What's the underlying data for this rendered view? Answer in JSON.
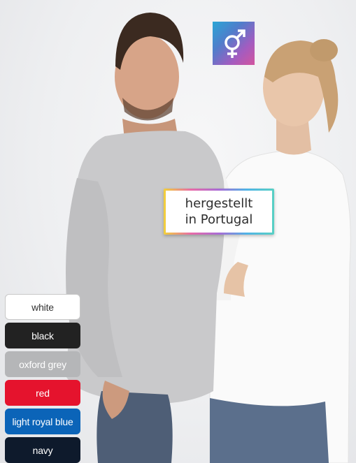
{
  "origin_badge": {
    "line1": "hergestellt",
    "line2": "in Portugal"
  },
  "gender_badge": {
    "icon": "unisex-gender-icon",
    "color_start": "#2aa6d6",
    "color_end": "#d3559e"
  },
  "colors": [
    {
      "label": "white",
      "bg": "#ffffff",
      "fg": "#333333",
      "border": "#c8c8c8"
    },
    {
      "label": "black",
      "bg": "#222222",
      "fg": "#ffffff",
      "border": "#222222"
    },
    {
      "label": "oxford grey",
      "bg": "#b5b6b8",
      "fg": "#ffffff",
      "border": "#b5b6b8"
    },
    {
      "label": "red",
      "bg": "#e5132d",
      "fg": "#ffffff",
      "border": "#e5132d"
    },
    {
      "label": "light royal blue",
      "bg": "#0b64b8",
      "fg": "#ffffff",
      "border": "#0b64b8"
    },
    {
      "label": "navy",
      "bg": "#0e1a2c",
      "fg": "#ffffff",
      "border": "#0e1a2c"
    }
  ]
}
